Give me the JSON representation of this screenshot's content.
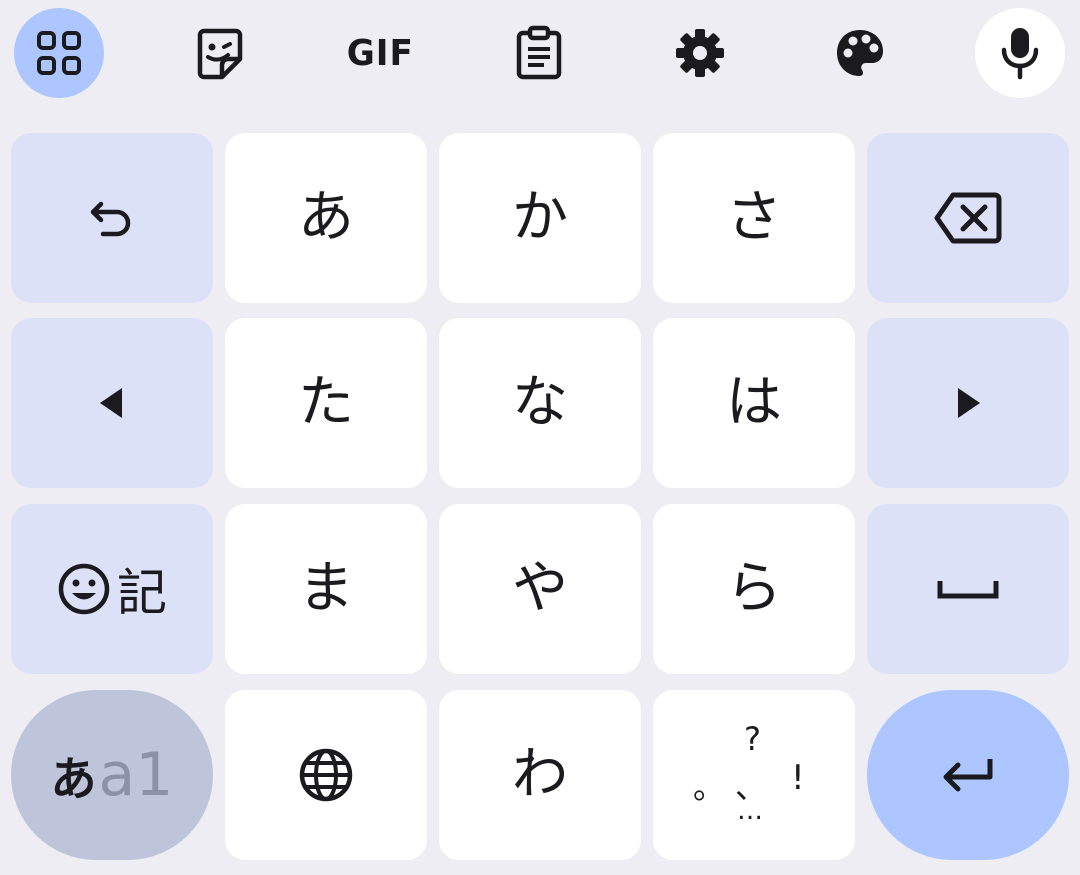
{
  "toolbar": {
    "gif_label": "GIF"
  },
  "keys": {
    "a": "あ",
    "ka": "か",
    "sa": "さ",
    "ta": "た",
    "na": "な",
    "ha": "は",
    "ma": "ま",
    "ya": "や",
    "ra": "ら",
    "wa": "わ",
    "symbols_label": "記",
    "mode_primary": "あ",
    "mode_secondary": "a1",
    "punct_question": "?",
    "punct_maru": "。",
    "punct_ten": "、",
    "punct_exclaim": "!",
    "punct_ellipsis": "…"
  },
  "colors": {
    "background": "#eeedf3",
    "char_key": "#ffffff",
    "func_key": "#dde1f8",
    "accent": "#adc6ff",
    "mode_key": "#bec5da"
  }
}
